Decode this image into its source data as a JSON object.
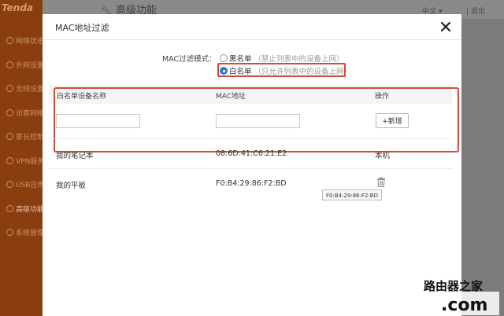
{
  "app": {
    "logo": "Tenda",
    "header_title": "高级功能",
    "language": "中文",
    "logout": "退出"
  },
  "sidebar": {
    "items": [
      {
        "label": "网络状态"
      },
      {
        "label": "外网设置"
      },
      {
        "label": "无线设置"
      },
      {
        "label": "访客网络"
      },
      {
        "label": "家长控制"
      },
      {
        "label": "VPN服务"
      },
      {
        "label": "USB应用"
      },
      {
        "label": "高级功能",
        "active": true
      },
      {
        "label": "系统管理"
      }
    ]
  },
  "modal": {
    "title": "MAC地址过滤",
    "mode_label": "MAC过滤模式：",
    "options": [
      {
        "label": "黑名单",
        "hint": "（禁止列表中的设备上网）",
        "selected": false
      },
      {
        "label": "白名单",
        "hint": "（只允许列表中的设备上网）",
        "selected": true
      }
    ],
    "table": {
      "headers": [
        "白名单设备名称",
        "MAC地址",
        "操作"
      ],
      "new_name_placeholder": "",
      "new_mac_placeholder": "",
      "add_label": "+新增",
      "rows": [
        {
          "name": "我的笔记本",
          "mac": "08:6D:41:C6:21:E2",
          "action": "本机"
        },
        {
          "name": "我的平板",
          "mac": "F0:B4:29:86:F2:BD",
          "action_icon": "trash-icon"
        }
      ]
    },
    "tooltip": "F0:B4:29:86:F2:BD"
  },
  "watermark": "路由器之家",
  "colors": {
    "highlight": "#d44a3a",
    "radio_selected": "#2a7fd0",
    "sidebar_bg": "#8a3e10"
  }
}
